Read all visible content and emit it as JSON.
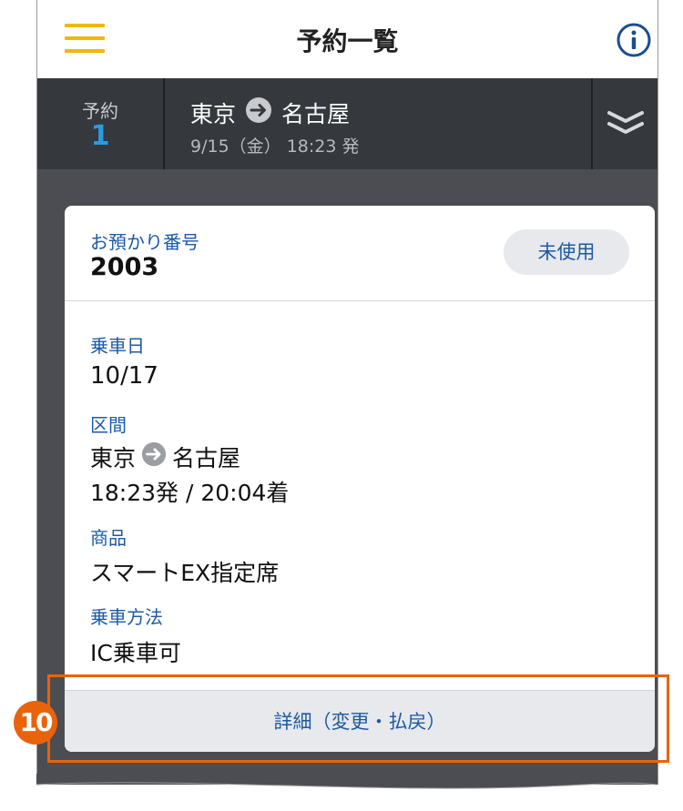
{
  "header": {
    "title": "予約一覧"
  },
  "summary": {
    "count_label": "予約",
    "count_value": "1",
    "origin": "東京",
    "destination": "名古屋",
    "datetime": "9/15（金） 18:23 発"
  },
  "card": {
    "reference_label": "お預かり番号",
    "reference_value": "2003",
    "status": "未使用",
    "boarding_date_label": "乗車日",
    "boarding_date": "10/17",
    "route_label": "区間",
    "route_origin": "東京",
    "route_destination": "名古屋",
    "route_times": "18:23発 / 20:04着",
    "product_label": "商品",
    "product": "スマートEX指定席",
    "method_label": "乗車方法",
    "method": "IC乗車可",
    "detail_button": "詳細（変更・払戻）"
  },
  "annotation": {
    "step_number": "10"
  },
  "colors": {
    "accent_yellow": "#f2b705",
    "link_blue": "#1c5aa6",
    "count_blue": "#2d9ae0",
    "highlight_orange": "#e8630a",
    "dark_bar": "#35383d"
  },
  "icons": {
    "menu": "hamburger-menu-icon",
    "info": "info-circle-icon",
    "arrow": "right-arrow-circle-icon",
    "toggle": "double-chevron-down-icon"
  }
}
